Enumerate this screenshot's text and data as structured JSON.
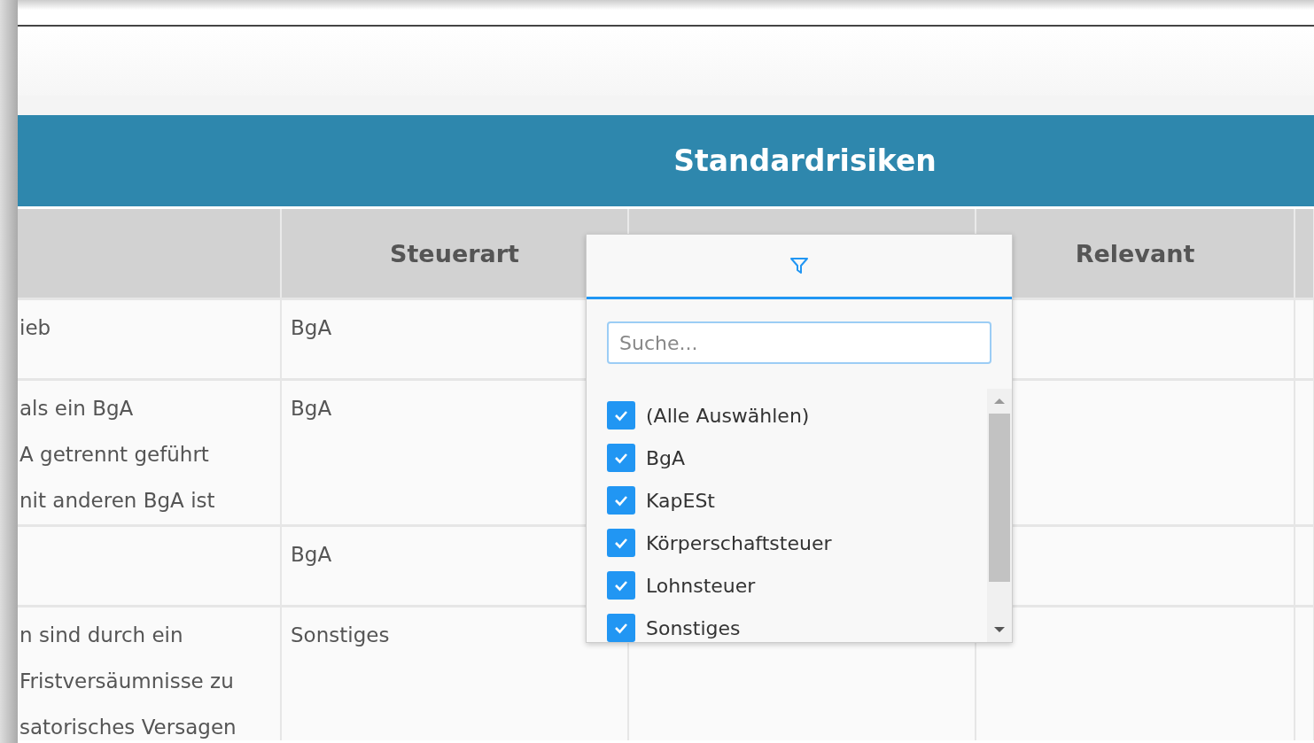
{
  "banner": {
    "title": "Standardrisiken"
  },
  "columns": [
    {
      "label": "Steuerart"
    },
    {
      "label": "Relevant"
    }
  ],
  "rows": [
    {
      "column_1": [
        "ieb"
      ],
      "steuerart": "BgA"
    },
    {
      "column_1": [
        "als ein BgA",
        "A getrennt geführt",
        "nit anderen BgA ist"
      ],
      "steuerart": "BgA"
    },
    {
      "steuerart": "BgA"
    },
    {
      "column_1": [
        "n sind durch ein",
        "Fristversäumnisse zu",
        "satorisches Versagen"
      ],
      "steuerart": "Sonstiges"
    }
  ],
  "filter_popup": {
    "search": {
      "placeholder": "Suche..."
    },
    "options": [
      {
        "label": "(Alle Auswählen)",
        "checked": true
      },
      {
        "label": "BgA",
        "checked": true
      },
      {
        "label": "KapESt",
        "checked": true
      },
      {
        "label": "Körperschaftsteuer",
        "checked": true
      },
      {
        "label": "Lohnsteuer",
        "checked": true
      },
      {
        "label": "Sonstiges",
        "checked": true
      }
    ]
  }
}
